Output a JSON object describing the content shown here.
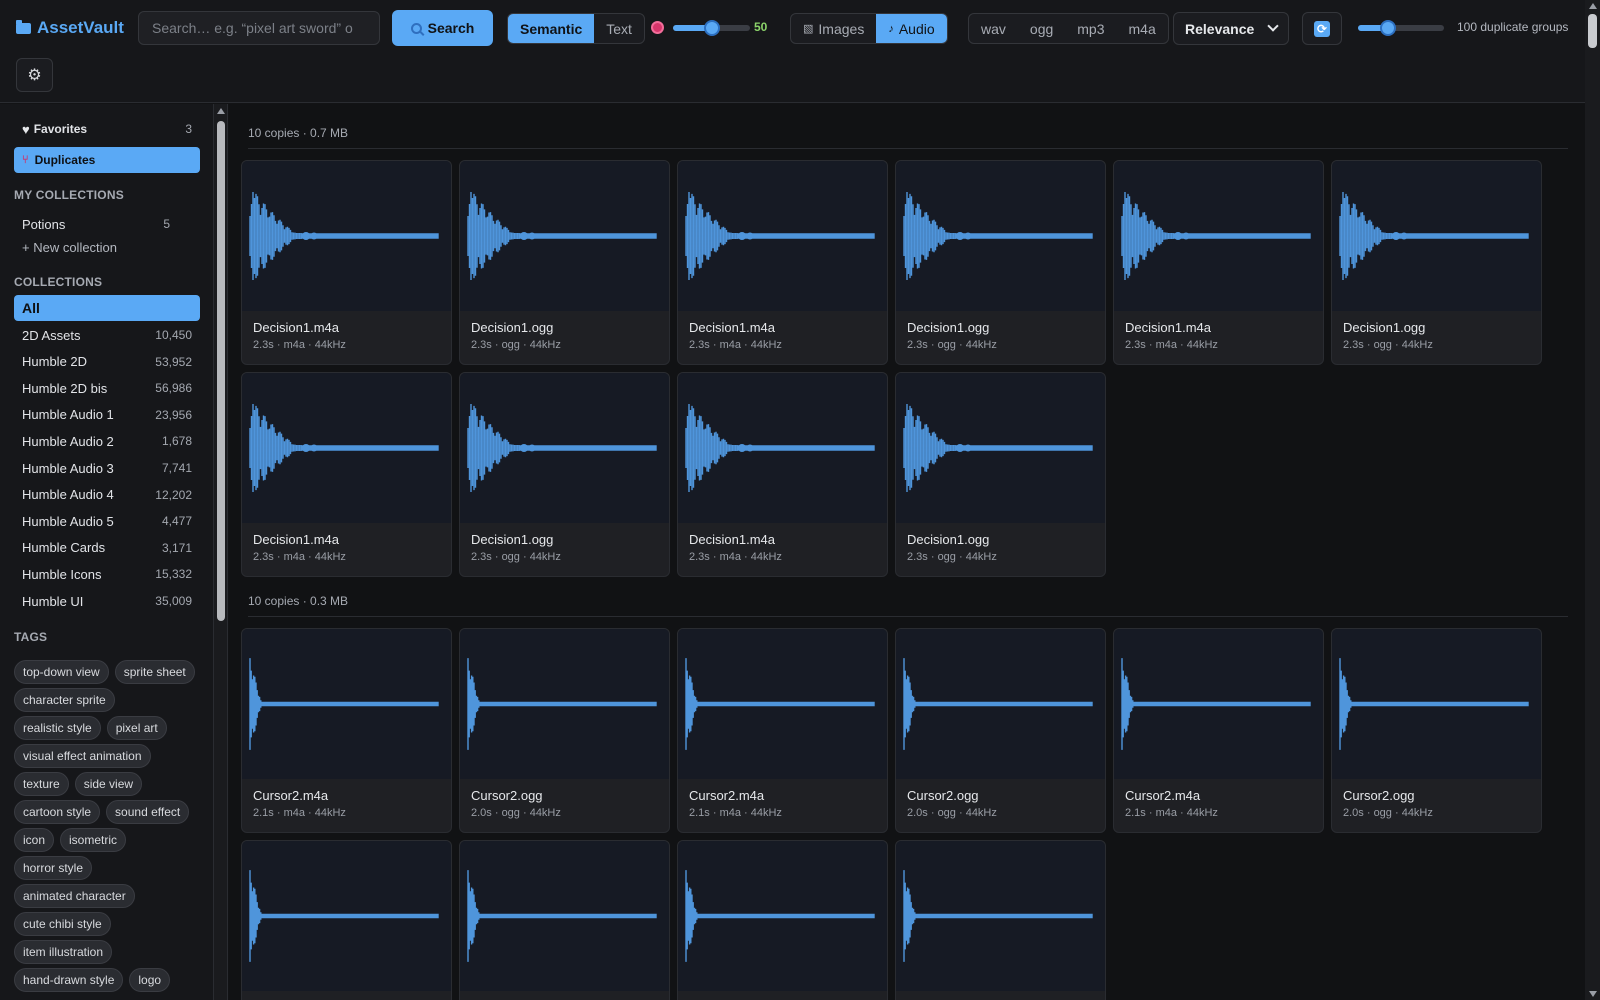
{
  "app": {
    "name": "AssetVault"
  },
  "search": {
    "placeholder": "Search… e.g. “pixel art sword” o",
    "button_label": "Search"
  },
  "mode": {
    "options": [
      "Semantic",
      "Text"
    ],
    "selected": "Semantic"
  },
  "similarity": {
    "value": "50",
    "level": 0.5
  },
  "media_type": {
    "images_label": "Images",
    "audio_label": "Audio",
    "selected": "Audio"
  },
  "formats": [
    "wav",
    "ogg",
    "mp3",
    "m4a"
  ],
  "sort": {
    "selected": "Relevance"
  },
  "duplicates": {
    "label": "100 duplicate groups",
    "level": 0.35
  },
  "sidebar": {
    "favorites": {
      "label": "Favorites",
      "count": "3"
    },
    "duplicates_label": "Duplicates",
    "my_collections_heading": "MY COLLECTIONS",
    "my_collections": [
      {
        "label": "Potions",
        "count": "5"
      }
    ],
    "new_collection_label": "+ New collection",
    "collections_heading": "COLLECTIONS",
    "collections": [
      {
        "label": "All",
        "count": ""
      },
      {
        "label": "2D Assets",
        "count": "10,450"
      },
      {
        "label": "Humble 2D",
        "count": "53,952"
      },
      {
        "label": "Humble 2D bis",
        "count": "56,986"
      },
      {
        "label": "Humble Audio 1",
        "count": "23,956"
      },
      {
        "label": "Humble Audio 2",
        "count": "1,678"
      },
      {
        "label": "Humble Audio 3",
        "count": "7,741"
      },
      {
        "label": "Humble Audio 4",
        "count": "12,202"
      },
      {
        "label": "Humble Audio 5",
        "count": "4,477"
      },
      {
        "label": "Humble Cards",
        "count": "3,171"
      },
      {
        "label": "Humble Icons",
        "count": "15,332"
      },
      {
        "label": "Humble UI",
        "count": "35,009"
      }
    ],
    "tags_heading": "TAGS",
    "tags": [
      "top-down view",
      "sprite sheet",
      "character sprite",
      "realistic style",
      "pixel art",
      "visual effect animation",
      "texture",
      "side view",
      "cartoon style",
      "sound effect",
      "icon",
      "isometric",
      "horror style",
      "animated character",
      "cute chibi style",
      "item illustration",
      "hand-drawn style",
      "logo"
    ]
  },
  "groups": [
    {
      "header": "10 copies · 0.7 MB",
      "items": [
        {
          "name": "Decision1.m4a",
          "meta": "2.3s · m4a · 44kHz"
        },
        {
          "name": "Decision1.ogg",
          "meta": "2.3s · ogg · 44kHz"
        },
        {
          "name": "Decision1.m4a",
          "meta": "2.3s · m4a · 44kHz"
        },
        {
          "name": "Decision1.ogg",
          "meta": "2.3s · ogg · 44kHz"
        },
        {
          "name": "Decision1.m4a",
          "meta": "2.3s · m4a · 44kHz"
        },
        {
          "name": "Decision1.ogg",
          "meta": "2.3s · ogg · 44kHz"
        },
        {
          "name": "Decision1.m4a",
          "meta": "2.3s · m4a · 44kHz"
        },
        {
          "name": "Decision1.ogg",
          "meta": "2.3s · ogg · 44kHz"
        },
        {
          "name": "Decision1.m4a",
          "meta": "2.3s · m4a · 44kHz"
        },
        {
          "name": "Decision1.ogg",
          "meta": "2.3s · ogg · 44kHz"
        }
      ]
    },
    {
      "header": "10 copies · 0.3 MB",
      "items": [
        {
          "name": "Cursor2.m4a",
          "meta": "2.1s · m4a · 44kHz"
        },
        {
          "name": "Cursor2.ogg",
          "meta": "2.0s · ogg · 44kHz"
        },
        {
          "name": "Cursor2.m4a",
          "meta": "2.1s · m4a · 44kHz"
        },
        {
          "name": "Cursor2.ogg",
          "meta": "2.0s · ogg · 44kHz"
        },
        {
          "name": "Cursor2.m4a",
          "meta": "2.1s · m4a · 44kHz"
        },
        {
          "name": "Cursor2.ogg",
          "meta": "2.0s · ogg · 44kHz"
        },
        {
          "name": "",
          "meta": ""
        },
        {
          "name": "",
          "meta": ""
        },
        {
          "name": "",
          "meta": ""
        },
        {
          "name": "",
          "meta": ""
        }
      ]
    }
  ],
  "colors": {
    "accent": "#5aa9f5",
    "background": "#121315",
    "panel": "#1f2024",
    "slider_value": "#8bd36a"
  }
}
